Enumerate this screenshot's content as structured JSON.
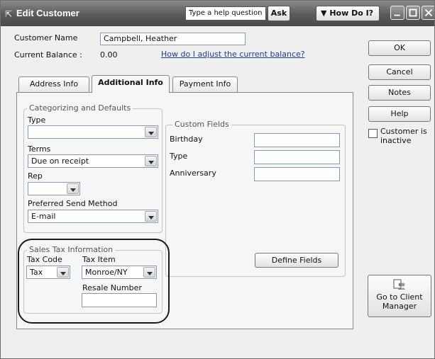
{
  "titlebar": {
    "title": "Edit Customer",
    "help_placeholder": "Type a help question",
    "ask_label": "Ask",
    "how_do_i_label": "How Do I?"
  },
  "customer": {
    "name_label": "Customer Name",
    "name_value": "Campbell, Heather",
    "balance_label": "Current Balance :",
    "balance_value": "0.00",
    "adjust_link": "How do I adjust the current balance?"
  },
  "tabs": [
    {
      "label": "Address Info"
    },
    {
      "label": "Additional Info"
    },
    {
      "label": "Payment Info"
    }
  ],
  "categorizing": {
    "legend": "Categorizing and Defaults",
    "type_label": "Type",
    "type_value": "",
    "terms_label": "Terms",
    "terms_value": "Due on receipt",
    "rep_label": "Rep",
    "rep_value": "",
    "send_method_label": "Preferred Send Method",
    "send_method_value": "E-mail"
  },
  "custom_fields": {
    "legend": "Custom Fields",
    "fields": [
      {
        "label": "Birthday",
        "value": ""
      },
      {
        "label": "Type",
        "value": ""
      },
      {
        "label": "Anniversary",
        "value": ""
      }
    ],
    "define_button": "Define Fields"
  },
  "sales_tax": {
    "legend": "Sales Tax Information",
    "tax_code_label": "Tax Code",
    "tax_code_value": "Tax",
    "tax_item_label": "Tax Item",
    "tax_item_value": "Monroe/NY",
    "resale_label": "Resale Number",
    "resale_value": ""
  },
  "actions": {
    "ok": "OK",
    "cancel": "Cancel",
    "notes": "Notes",
    "help": "Help",
    "inactive_label": "Customer is inactive",
    "client_manager_line1": "Go to Client",
    "client_manager_line2": "Manager"
  },
  "colors": {
    "titlebar": "#5a5a5a",
    "link": "#1c3d99",
    "window_bg": "#efefef"
  }
}
